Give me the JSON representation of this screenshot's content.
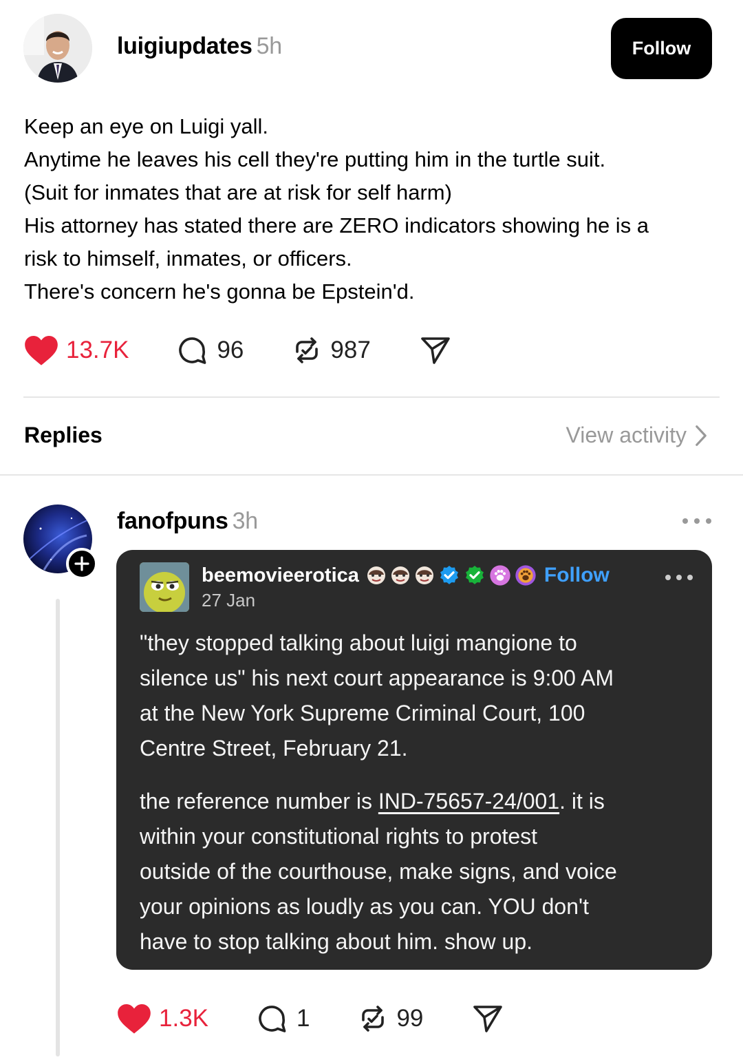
{
  "post": {
    "author": "luigiupdates",
    "time": "5h",
    "follow_label": "Follow",
    "lines": [
      "Keep an eye on Luigi yall.",
      "Anytime he leaves his cell they're putting him in the turtle suit.",
      "(Suit for inmates that are at risk for self harm)",
      "His attorney has stated there are ZERO indicators showing he is a",
      "risk to himself, inmates, or officers.",
      "There's concern he's gonna be Epstein'd."
    ],
    "likes": "13.7K",
    "comments": "96",
    "reposts": "987"
  },
  "replies_header": {
    "label": "Replies",
    "view_activity": "View activity"
  },
  "reply": {
    "author": "fanofpuns",
    "time": "3h",
    "likes": "1.3K",
    "comments": "1",
    "reposts": "99",
    "embed": {
      "author": "beemovieerotica",
      "follow_label": "Follow",
      "date": "27 Jan",
      "paragraph1_lines": [
        "\"they stopped talking about luigi mangione to",
        "silence us\" his next court appearance is 9:00 AM",
        "at the New York Supreme Criminal Court, 100",
        "Centre Street, February 21."
      ],
      "p2_pre": "the reference number is ",
      "p2_link": "IND-75657-24/001",
      "p2_post": ". it is",
      "paragraph2_lines": [
        "within your constitutional rights to protest",
        "outside of the courthouse, make signs, and voice",
        "your opinions as loudly as you can. YOU don't",
        "have to stop talking about him. show up."
      ]
    }
  },
  "colors": {
    "like_red": "#e8223b",
    "link_blue": "#3fa0ff",
    "card_bg": "#2b2b2b",
    "muted": "#999999"
  },
  "icons": [
    "heart-icon",
    "comment-icon",
    "repost-icon",
    "share-icon",
    "chevron-right-icon",
    "more-icon",
    "plus-icon",
    "verified-badge-icon"
  ]
}
